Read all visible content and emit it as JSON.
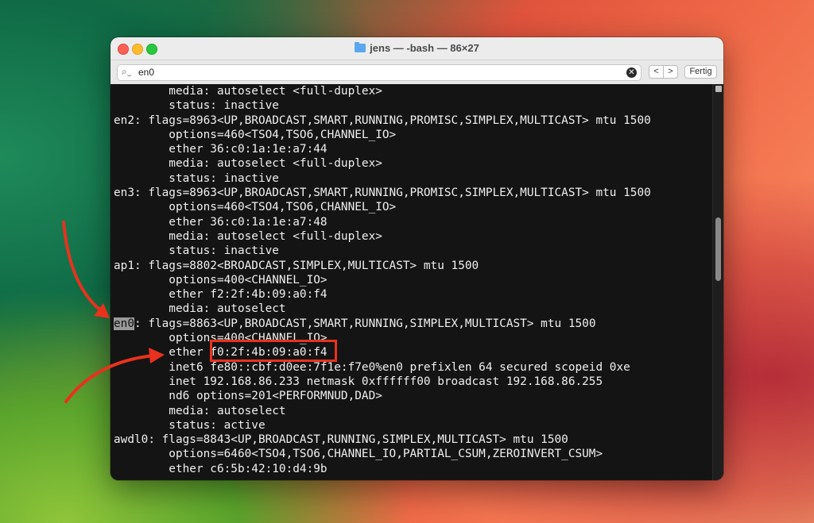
{
  "window": {
    "title": "jens — -bash — 86×27",
    "icon": "folder-icon"
  },
  "findbar": {
    "search_value": "en0",
    "prev_label": "<",
    "next_label": ">",
    "done_label": "Fertig"
  },
  "terminal": {
    "lines": [
      "        media: autoselect <full-duplex>",
      "        status: inactive",
      "en2: flags=8963<UP,BROADCAST,SMART,RUNNING,PROMISC,SIMPLEX,MULTICAST> mtu 1500",
      "        options=460<TSO4,TSO6,CHANNEL_IO>",
      "        ether 36:c0:1a:1e:a7:44",
      "        media: autoselect <full-duplex>",
      "        status: inactive",
      "en3: flags=8963<UP,BROADCAST,SMART,RUNNING,PROMISC,SIMPLEX,MULTICAST> mtu 1500",
      "        options=460<TSO4,TSO6,CHANNEL_IO>",
      "        ether 36:c0:1a:1e:a7:48",
      "        media: autoselect <full-duplex>",
      "        status: inactive",
      "ap1: flags=8802<BROADCAST,SIMPLEX,MULTICAST> mtu 1500",
      "        options=400<CHANNEL_IO>",
      "        ether f2:2f:4b:09:a0:f4",
      "        media: autoselect",
      ": flags=8863<UP,BROADCAST,SMART,RUNNING,SIMPLEX,MULTICAST> mtu 1500",
      "        options=400<CHANNEL_IO>",
      "        ether f0:2f:4b:09:a0:f4",
      "        inet6 fe80::cbf:d0ee:7f1e:f7e0%en0 prefixlen 64 secured scopeid 0xe",
      "        inet 192.168.86.233 netmask 0xffffff00 broadcast 192.168.86.255",
      "        nd6 options=201<PERFORMNUD,DAD>",
      "        media: autoselect",
      "        status: active",
      "awdl0: flags=8843<UP,BROADCAST,RUNNING,SIMPLEX,MULTICAST> mtu 1500",
      "        options=6460<TSO4,TSO6,CHANNEL_IO,PARTIAL_CSUM,ZEROINVERT_CSUM>",
      "        ether c6:5b:42:10:d4:9b"
    ],
    "highlight_match": "en0",
    "highlight_line_index": 16
  },
  "annotations": {
    "box_color": "#e8321d",
    "arrow_color": "#e8321d"
  }
}
